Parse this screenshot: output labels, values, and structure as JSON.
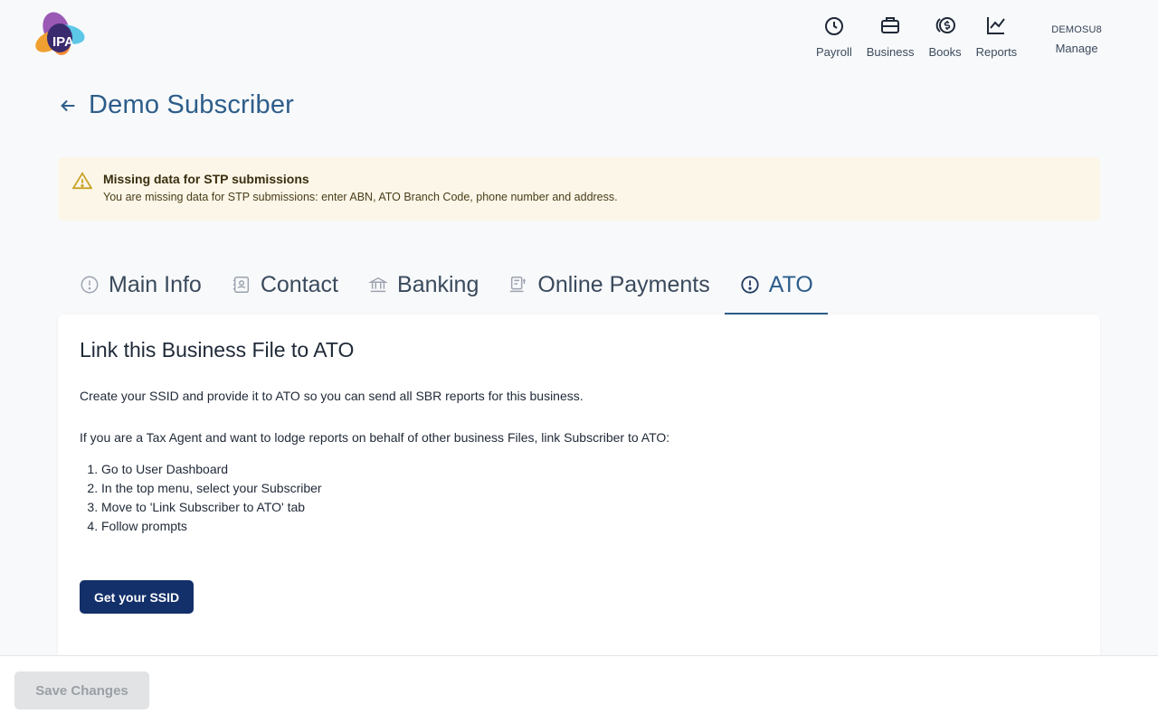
{
  "brand": {
    "logo_text": "IPA"
  },
  "topnav": {
    "items": [
      {
        "label": "Payroll",
        "icon": "clock-icon"
      },
      {
        "label": "Business",
        "icon": "briefcase-icon"
      },
      {
        "label": "Books",
        "icon": "coin-dollar-icon"
      },
      {
        "label": "Reports",
        "icon": "line-chart-icon"
      }
    ],
    "manage": {
      "subscriber_code": "DEMOSU8",
      "label": "Manage"
    }
  },
  "page": {
    "title": "Demo Subscriber"
  },
  "alert": {
    "title": "Missing data for STP submissions",
    "message": "You are missing data for STP submissions: enter ABN, ATO Branch Code, phone number and address.",
    "color": "#fbf6e7"
  },
  "tabs": [
    {
      "label": "Main Info",
      "icon": "info-circle-icon",
      "active": false
    },
    {
      "label": "Contact",
      "icon": "contact-card-icon",
      "active": false
    },
    {
      "label": "Banking",
      "icon": "bank-icon",
      "active": false
    },
    {
      "label": "Online Payments",
      "icon": "payment-terminal-icon",
      "active": false
    },
    {
      "label": "ATO",
      "icon": "alert-circle-icon",
      "active": true
    }
  ],
  "ato": {
    "heading": "Link this Business File to ATO",
    "intro": "Create your SSID and provide it to ATO so you can send all SBR reports for this business.",
    "agent_text": "If you are a Tax Agent and want to lodge reports on behalf of other business Files, link Subscriber to ATO:",
    "steps": [
      "Go to User Dashboard",
      "In the top menu, select your Subscriber",
      "Move to 'Link Subscriber to ATO' tab",
      "Follow prompts"
    ],
    "button_label": "Get your SSID"
  },
  "footer": {
    "save_label": "Save Changes",
    "save_disabled": true
  },
  "colors": {
    "accent": "#2d5d8a",
    "primary_button": "#13306a"
  }
}
